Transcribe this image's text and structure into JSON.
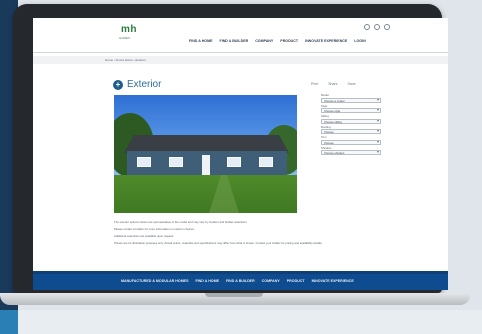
{
  "site": {
    "logo_text": "mh",
    "logo_subtitle": "HOMES",
    "nav_items": [
      "FIND A HOME",
      "FIND A BUILDER",
      "COMPANY",
      "PRODUCT",
      "INNOVATE EXPERIENCE",
      "LOGIN"
    ],
    "breadcrumb": "Home › Find a Home › Exterior"
  },
  "page": {
    "title": "Exterior",
    "tools": [
      "Print",
      "Share",
      "Save"
    ]
  },
  "filters": [
    {
      "label": "Model",
      "value": "Choose a model"
    },
    {
      "label": "Style",
      "value": "Choose style"
    },
    {
      "label": "Siding",
      "value": "Choose siding"
    },
    {
      "label": "Roofing",
      "value": "Choose"
    },
    {
      "label": "Trim",
      "value": "Choose"
    },
    {
      "label": "Shutters",
      "value": "Choose shutters"
    }
  ],
  "description": [
    "The exterior options shown are representative of the model and may vary by location and builder selections.",
    "Please contact a builder for more information on exterior choices.",
    "Additional selections are available upon request.",
    "Photos are for illustration purposes only. Actual colors, materials and specifications may differ from what is shown. Contact your builder for pricing and availability details."
  ],
  "footer": {
    "nav_items": [
      "MANUFACTURED & MODULAR HOMES",
      "FIND A HOME",
      "FIND A BUILDER",
      "COMPANY",
      "PRODUCT",
      "INNOVATE EXPERIENCE"
    ]
  },
  "colors": {
    "brand_green": "#2c7a3f",
    "footer_blue": "#0e4b8f",
    "title_blue": "#2d6f9e"
  }
}
